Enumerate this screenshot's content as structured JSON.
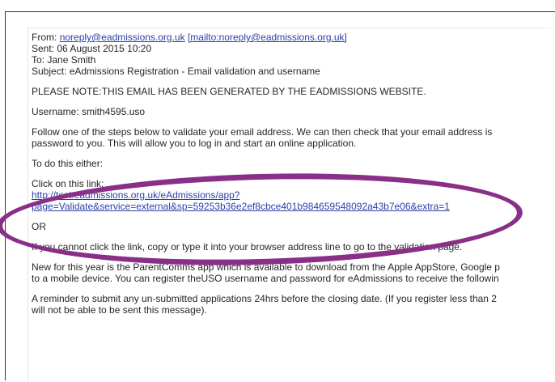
{
  "email": {
    "from_label": "From:",
    "from_address": "noreply@eadmissions.org.uk",
    "from_mailto": "[mailto:noreply@eadmissions.org.uk]",
    "sent": "Sent: 06 August 2015 10:20",
    "to": "To: Jane Smith",
    "subject": "Subject: eAdmissions Registration - Email validation and username",
    "notice": "PLEASE NOTE:THIS EMAIL HAS BEEN GENERATED BY THE EADMISSIONS WEBSITE.",
    "username": "Username: smith4595.uso",
    "instructions_1": "Follow one of the steps below to validate your email address.  We can then check that your email address is",
    "instructions_2": "password to you.  This will allow you to log in and start an online application.",
    "to_do_this": "To do this either:",
    "click_label": "Click on this link:",
    "link_line_1": "http://test.eadmissions.org.uk/eAdmissions/app?",
    "link_line_2": "page=Validate&service=external&sp=59253b36e2ef8cbce401b984659548092a43b7e06&extra=1",
    "or": "OR",
    "copy_instruction": "If you cannot click the link, copy or type it into your browser address line to go to the validation page.",
    "parentcomms_1": "New for this year is the ParentComms app which is available to download from the Apple AppStore, Google p",
    "parentcomms_2": "to a mobile device. You can register theUSO username and password for eAdmissions to receive the followin",
    "reminder_1": "A reminder to submit any un-submitted applications 24hrs before the closing date. (If you register less than 2",
    "reminder_2": "will not be able to be sent this message)."
  },
  "annotation": {
    "color": "#8a2f87"
  }
}
